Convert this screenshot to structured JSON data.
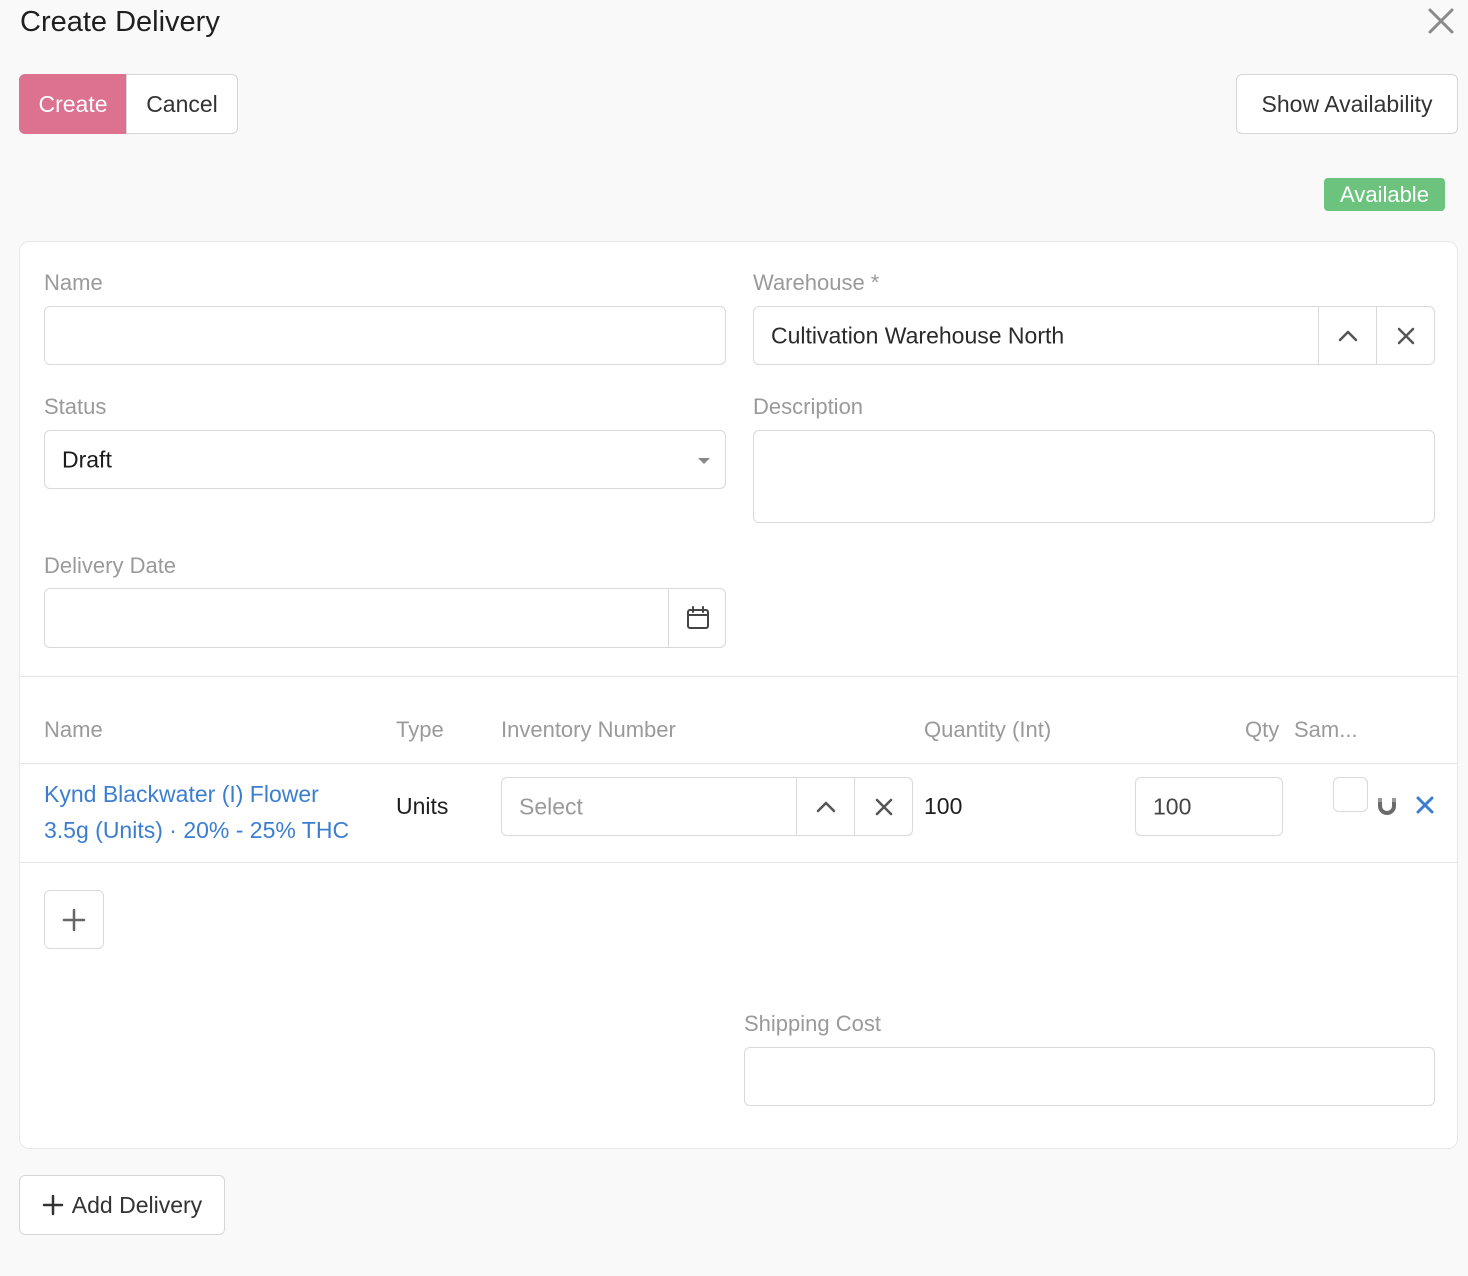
{
  "dialog": {
    "title": "Create Delivery",
    "create_label": "Create",
    "cancel_label": "Cancel",
    "show_availability_label": "Show Availability",
    "availability_badge": "Available",
    "add_delivery_label": "Add Delivery"
  },
  "form": {
    "name_label": "Name",
    "name_value": "",
    "warehouse_label": "Warehouse *",
    "warehouse_value": "Cultivation Warehouse North",
    "status_label": "Status",
    "status_value": "Draft",
    "description_label": "Description",
    "description_value": "",
    "delivery_date_label": "Delivery Date",
    "delivery_date_value": "",
    "shipping_cost_label": "Shipping Cost",
    "shipping_cost_value": ""
  },
  "table": {
    "headers": [
      "Name",
      "Type",
      "Inventory Number",
      "Quantity (Int)",
      "Qty",
      "Sam..."
    ],
    "rows": [
      {
        "name_line1": "Kynd Blackwater (I) Flower",
        "name_line2": "3.5g (Units) · 20% - 25% THC",
        "type": "Units",
        "inventory_placeholder": "Select",
        "quantity": "100",
        "qty_input": "100"
      }
    ]
  },
  "colors": {
    "primary": "#dc7190",
    "badge_green": "#6cc37d",
    "link_blue": "#3b7ed0"
  },
  "icons": [
    "close-icon",
    "chevron-up-icon",
    "clear-icon",
    "caret-down-icon",
    "calendar-icon",
    "magnet-icon",
    "remove-row-icon",
    "plus-icon"
  ]
}
